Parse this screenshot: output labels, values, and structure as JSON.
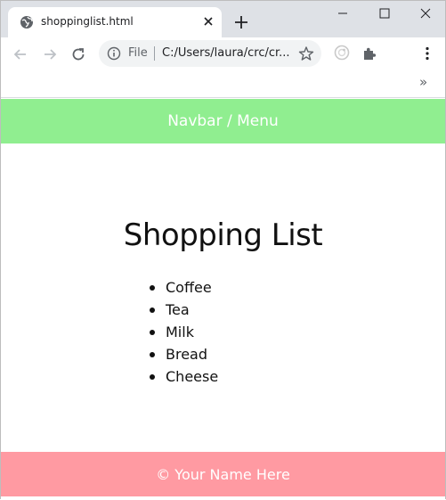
{
  "browser": {
    "tab_title": "shoppinglist.html",
    "omnibox": {
      "scheme_label": "File",
      "url": "C:/Users/laura/crc/cr..."
    },
    "bookmarks_overflow": "»"
  },
  "page": {
    "navbar_text": "Navbar / Menu",
    "heading": "Shopping List",
    "items": [
      "Coffee",
      "Tea",
      "Milk",
      "Bread",
      "Cheese"
    ],
    "footer_text": "© Your Name Here"
  },
  "colors": {
    "navbar_bg": "#90ee90",
    "footer_bg": "#ff9aa2",
    "tabstrip_bg": "#dee1e6"
  }
}
